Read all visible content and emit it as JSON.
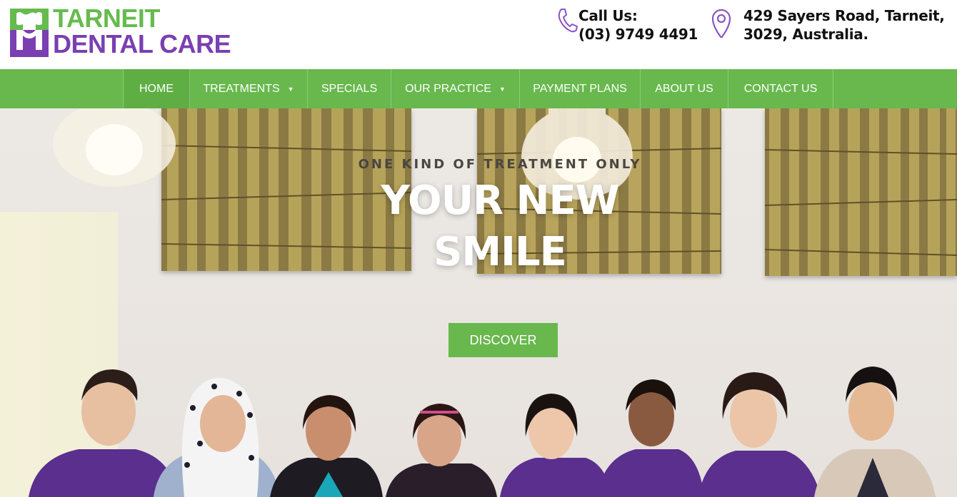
{
  "brand": {
    "line1": "TARNEIT",
    "line2": "DENTAL CARE",
    "green": "#66bb4e",
    "purple": "#7a3fb1",
    "logo_icon": "tooth-icon"
  },
  "contact": {
    "call_title": "Call Us:",
    "phone": "(03) 9749 4491",
    "call_icon": "phone-icon",
    "address_line1": "429 Sayers Road, Tarneit,",
    "address_line2": "3029, Australia.",
    "address_icon": "map-pin-icon"
  },
  "nav": {
    "items": [
      {
        "label": "HOME",
        "has_dropdown": false,
        "active": true
      },
      {
        "label": "TREATMENTS",
        "has_dropdown": true,
        "active": false
      },
      {
        "label": "SPECIALS",
        "has_dropdown": false,
        "active": false
      },
      {
        "label": "OUR PRACTICE",
        "has_dropdown": true,
        "active": false
      },
      {
        "label": "PAYMENT PLANS",
        "has_dropdown": false,
        "active": false
      },
      {
        "label": "ABOUT US",
        "has_dropdown": false,
        "active": false
      },
      {
        "label": "CONTACT US",
        "has_dropdown": false,
        "active": false
      }
    ],
    "caret": "▼",
    "background": "#68b84d"
  },
  "hero": {
    "subtitle": "ONE KIND OF TREATMENT ONLY",
    "title_line1": "YOUR NEW",
    "title_line2": "SMILE",
    "cta_label": "DISCOVER",
    "cta_color": "#68b84d"
  }
}
